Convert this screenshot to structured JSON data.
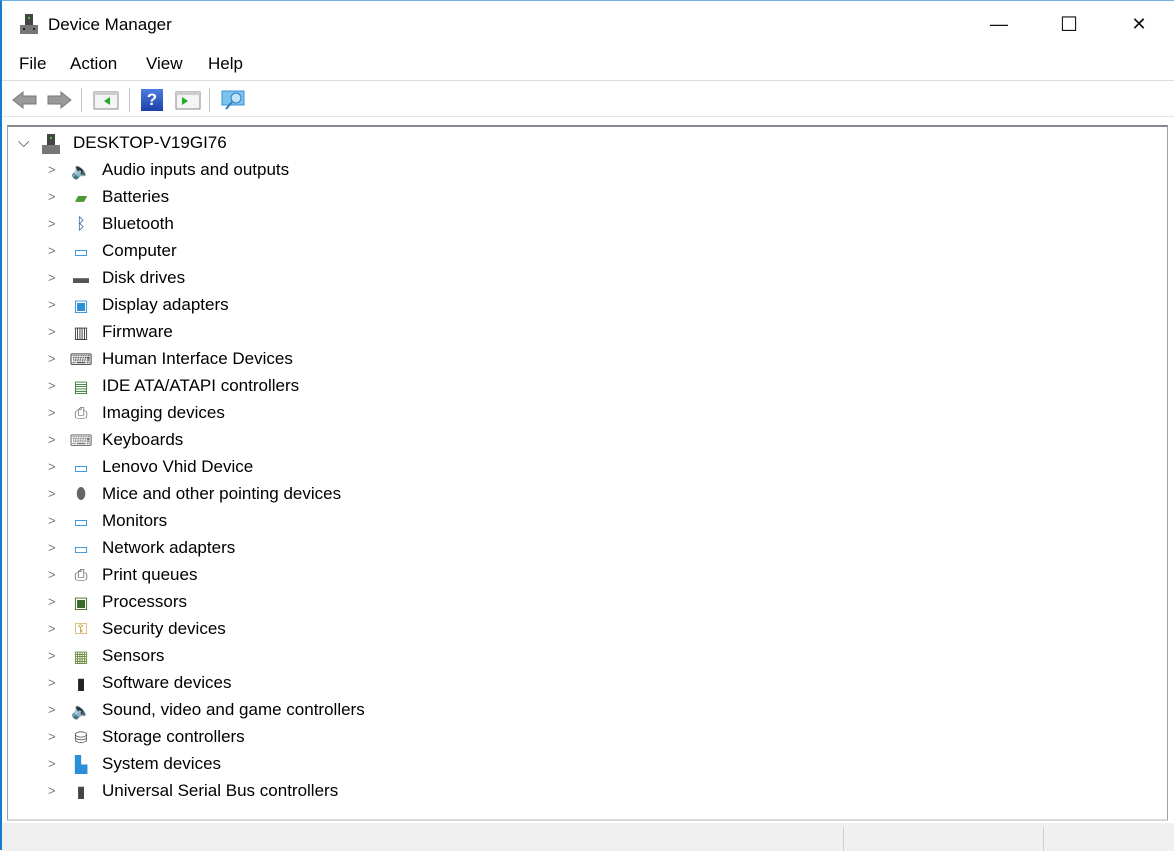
{
  "window": {
    "title": "Device Manager",
    "minimize": "—",
    "maximize": "☐",
    "close": "✕"
  },
  "menu": [
    "File",
    "Action",
    "View",
    "Help"
  ],
  "toolbar": {
    "back": "back-icon",
    "forward": "forward-icon",
    "show_hide": "console-tree-icon",
    "help": "?",
    "properties": "properties-icon",
    "scan": "scan-hardware-icon"
  },
  "tree": {
    "root": "DESKTOP-V19GI76",
    "items": [
      {
        "label": "Audio inputs and outputs",
        "icon": "speaker-icon",
        "glyph": "🔈",
        "color": "#888"
      },
      {
        "label": "Batteries",
        "icon": "battery-icon",
        "glyph": "▰",
        "color": "#4a9a3a"
      },
      {
        "label": "Bluetooth",
        "icon": "bluetooth-icon",
        "glyph": "ᛒ",
        "color": "#1d4e9e"
      },
      {
        "label": "Computer",
        "icon": "computer-icon",
        "glyph": "▭",
        "color": "#2b8fd8"
      },
      {
        "label": "Disk drives",
        "icon": "disk-drive-icon",
        "glyph": "▬",
        "color": "#555"
      },
      {
        "label": "Display adapters",
        "icon": "display-adapter-icon",
        "glyph": "▣",
        "color": "#2b8fd8"
      },
      {
        "label": "Firmware",
        "icon": "firmware-icon",
        "glyph": "▥",
        "color": "#333"
      },
      {
        "label": "Human Interface Devices",
        "icon": "hid-icon",
        "glyph": "⌨",
        "color": "#555"
      },
      {
        "label": "IDE ATA/ATAPI controllers",
        "icon": "ide-controller-icon",
        "glyph": "▤",
        "color": "#3a7a3a"
      },
      {
        "label": "Imaging devices",
        "icon": "camera-icon",
        "glyph": "⎙",
        "color": "#555"
      },
      {
        "label": "Keyboards",
        "icon": "keyboard-icon",
        "glyph": "⌨",
        "color": "#777"
      },
      {
        "label": "Lenovo Vhid Device",
        "icon": "network-monitor-icon",
        "glyph": "▭",
        "color": "#2b8fd8"
      },
      {
        "label": "Mice and other pointing devices",
        "icon": "mouse-icon",
        "glyph": "⬮",
        "color": "#666"
      },
      {
        "label": "Monitors",
        "icon": "monitor-icon",
        "glyph": "▭",
        "color": "#2b8fd8"
      },
      {
        "label": "Network adapters",
        "icon": "network-adapter-icon",
        "glyph": "▭",
        "color": "#2b8fd8"
      },
      {
        "label": "Print queues",
        "icon": "printer-icon",
        "glyph": "⎙",
        "color": "#444"
      },
      {
        "label": "Processors",
        "icon": "processor-icon",
        "glyph": "▣",
        "color": "#3a6a2a"
      },
      {
        "label": "Security devices",
        "icon": "security-key-icon",
        "glyph": "⚿",
        "color": "#b8860b"
      },
      {
        "label": "Sensors",
        "icon": "sensor-icon",
        "glyph": "▦",
        "color": "#6a8a3a"
      },
      {
        "label": "Software devices",
        "icon": "software-device-icon",
        "glyph": "▮",
        "color": "#222"
      },
      {
        "label": "Sound, video and game controllers",
        "icon": "speaker-icon",
        "glyph": "🔈",
        "color": "#888"
      },
      {
        "label": "Storage controllers",
        "icon": "storage-controller-icon",
        "glyph": "⛁",
        "color": "#555"
      },
      {
        "label": "System devices",
        "icon": "system-device-icon",
        "glyph": "▙",
        "color": "#2b8fd8"
      },
      {
        "label": "Universal Serial Bus controllers",
        "icon": "usb-icon",
        "glyph": "▮",
        "color": "#444"
      }
    ]
  }
}
